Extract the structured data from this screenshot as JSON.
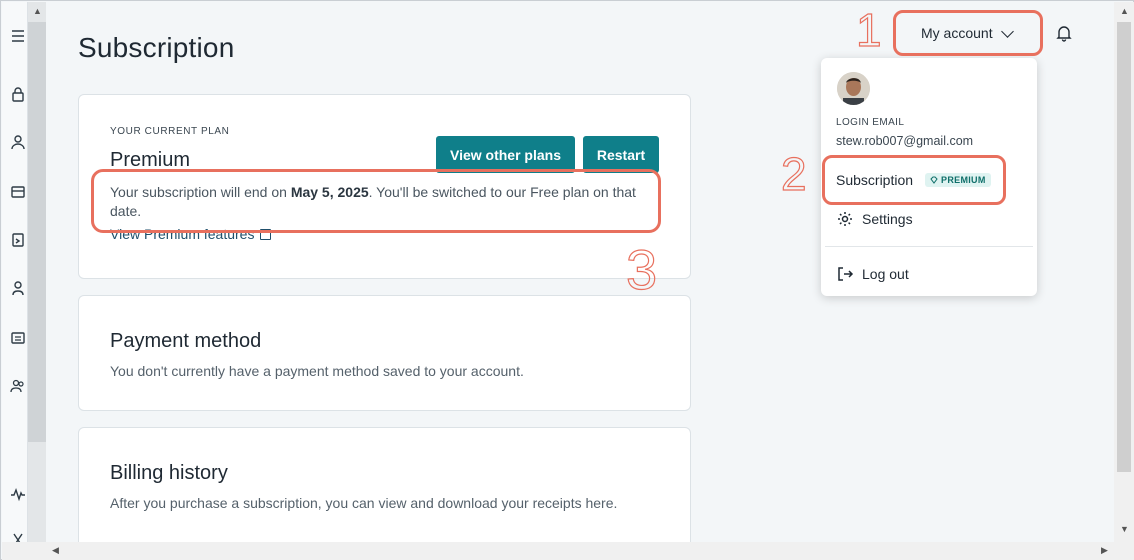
{
  "page": {
    "title": "Subscription"
  },
  "header": {
    "account_label": "My account"
  },
  "plan_card": {
    "eyebrow": "YOUR CURRENT PLAN",
    "plan_name": "Premium",
    "view_other_plans_label": "View other plans",
    "restart_label": "Restart",
    "message_prefix": "Your subscription will end on ",
    "message_date": "May 5, 2025",
    "message_suffix": ". You'll be switched to our Free plan on that date.",
    "features_link": "View Premium features"
  },
  "payment_card": {
    "title": "Payment method",
    "description": "You don't currently have a payment method saved to your account."
  },
  "billing_card": {
    "title": "Billing history",
    "description": "After you purchase a subscription, you can view and download your receipts here."
  },
  "account_menu": {
    "login_label": "LOGIN EMAIL",
    "email": "stew.rob007@gmail.com",
    "subscription_label": "Subscription",
    "subscription_badge": "PREMIUM",
    "settings_label": "Settings",
    "logout_label": "Log out"
  },
  "annotations": {
    "n1": "1",
    "n2": "2",
    "n3": "3"
  },
  "colors": {
    "accent": "#0f7f8a",
    "annotation": "#e8705e",
    "badge_bg": "#dff3f1"
  }
}
